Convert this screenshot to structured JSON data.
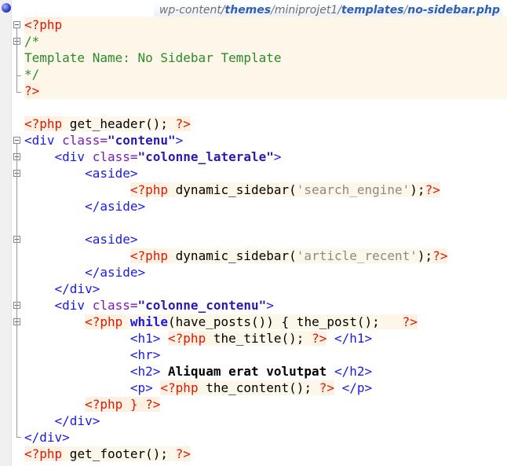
{
  "breadcrumb": {
    "prefix": "wp-content/",
    "segments": [
      "themes",
      "miniprojet1",
      "templates",
      "no-sidebar.php"
    ],
    "separator": "/"
  },
  "code": {
    "l1": "<?php",
    "l2": "/*",
    "l3": "Template Name: No Sidebar Template",
    "l4": "*/",
    "l5": "?>",
    "l7a": "<?php",
    "l7b": " get_header",
    "l7c": "(); ",
    "l7d": "?>",
    "l8a": "<div",
    "l8b": " class=",
    "l8c": "\"contenu\"",
    "l8d": ">",
    "l9ind": "    ",
    "l9a": "<div",
    "l9b": " class=",
    "l9c": "\"colonne_laterale\"",
    "l9d": ">",
    "aside_open": "<aside>",
    "aside_close": "</aside>",
    "php_open": "<?php",
    "php_close": "?>",
    "dyn_fn": " dynamic_sidebar(",
    "dyn_end": ");",
    "sq1": "'search_engine'",
    "sq2": "'article_recent'",
    "div_close": "</div>",
    "l18a": "<div",
    "l18b": " class=",
    "l18c": "\"colonne_contenu\"",
    "l18d": ">",
    "l19kw": "while",
    "l19a": "(have_posts()) { the_post();   ",
    "h1_open": "<h1>",
    "h1_close": "</h1>",
    "the_title": " the_title(); ",
    "hr": "<hr>",
    "h2_open": "<h2>",
    "h2_text": " Aliquam erat volutpat ",
    "h2_close": "</h2>",
    "p_open": "<p>",
    "p_close": "</p>",
    "the_content": " the_content(); ",
    "brace": " } ",
    "get_footer": " get_footer(); "
  },
  "colors": {
    "php_tag": "#d91a00",
    "comment": "#2b8a2b",
    "html_tag": "#1a1ae6",
    "attribute": "#7a1ab8",
    "string": "#2b1ab0",
    "php_background": "#fdf7ea"
  },
  "icons": {
    "bullet": "breakpoint-bullet-icon",
    "fold": "fold-collapse-icon"
  }
}
